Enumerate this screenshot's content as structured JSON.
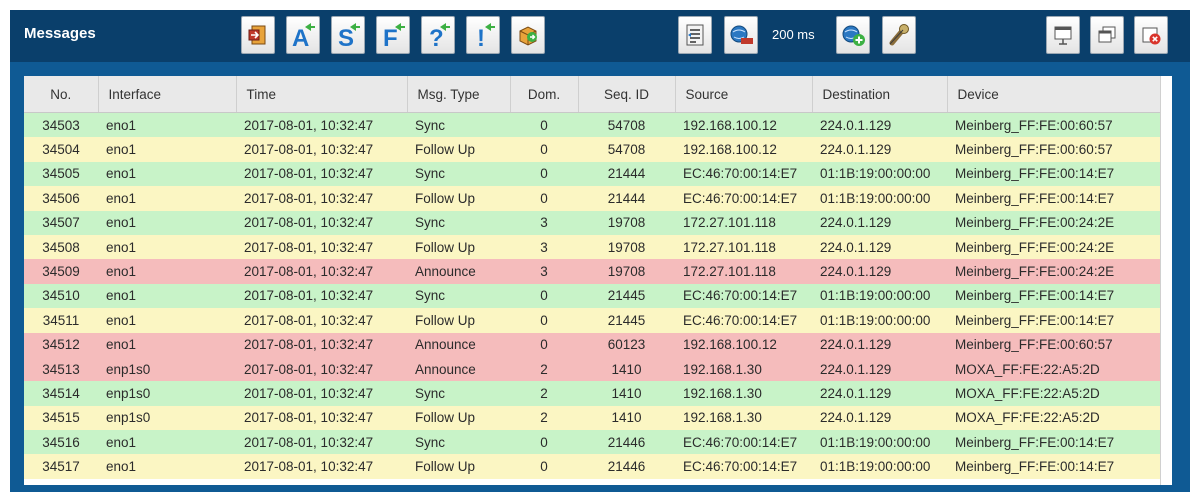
{
  "header": {
    "title": "Messages",
    "speed": "200 ms"
  },
  "toolbar": {
    "capture_icons": [
      "log-export-icon",
      "filter-all-icon",
      "filter-sync-icon",
      "filter-followup-icon",
      "filter-query-icon",
      "filter-flag-icon",
      "export-box-icon"
    ],
    "control_icons": [
      "list-settings-icon",
      "stop-capture-icon",
      "add-network-icon",
      "wrench-icon"
    ],
    "window_icons": [
      "detach-window-icon",
      "restore-window-icon",
      "close-window-icon"
    ]
  },
  "table": {
    "columns": [
      "No.",
      "Interface",
      "Time",
      "Msg. Type",
      "Dom.",
      "Seq. ID",
      "Source",
      "Destination",
      "Device"
    ],
    "rows": [
      {
        "type": "sync",
        "cells": [
          "34503",
          "eno1",
          "2017-08-01, 10:32:47",
          "Sync",
          "0",
          "54708",
          "192.168.100.12",
          "224.0.1.129",
          "Meinberg_FF:FE:00:60:57"
        ]
      },
      {
        "type": "follow",
        "cells": [
          "34504",
          "eno1",
          "2017-08-01, 10:32:47",
          "Follow Up",
          "0",
          "54708",
          "192.168.100.12",
          "224.0.1.129",
          "Meinberg_FF:FE:00:60:57"
        ]
      },
      {
        "type": "sync",
        "cells": [
          "34505",
          "eno1",
          "2017-08-01, 10:32:47",
          "Sync",
          "0",
          "21444",
          "EC:46:70:00:14:E7",
          "01:1B:19:00:00:00",
          "Meinberg_FF:FE:00:14:E7"
        ]
      },
      {
        "type": "follow",
        "cells": [
          "34506",
          "eno1",
          "2017-08-01, 10:32:47",
          "Follow Up",
          "0",
          "21444",
          "EC:46:70:00:14:E7",
          "01:1B:19:00:00:00",
          "Meinberg_FF:FE:00:14:E7"
        ]
      },
      {
        "type": "sync",
        "cells": [
          "34507",
          "eno1",
          "2017-08-01, 10:32:47",
          "Sync",
          "3",
          "19708",
          "172.27.101.118",
          "224.0.1.129",
          "Meinberg_FF:FE:00:24:2E"
        ]
      },
      {
        "type": "follow",
        "cells": [
          "34508",
          "eno1",
          "2017-08-01, 10:32:47",
          "Follow Up",
          "3",
          "19708",
          "172.27.101.118",
          "224.0.1.129",
          "Meinberg_FF:FE:00:24:2E"
        ]
      },
      {
        "type": "announce",
        "cells": [
          "34509",
          "eno1",
          "2017-08-01, 10:32:47",
          "Announce",
          "3",
          "19708",
          "172.27.101.118",
          "224.0.1.129",
          "Meinberg_FF:FE:00:24:2E"
        ]
      },
      {
        "type": "sync",
        "cells": [
          "34510",
          "eno1",
          "2017-08-01, 10:32:47",
          "Sync",
          "0",
          "21445",
          "EC:46:70:00:14:E7",
          "01:1B:19:00:00:00",
          "Meinberg_FF:FE:00:14:E7"
        ]
      },
      {
        "type": "follow",
        "cells": [
          "34511",
          "eno1",
          "2017-08-01, 10:32:47",
          "Follow Up",
          "0",
          "21445",
          "EC:46:70:00:14:E7",
          "01:1B:19:00:00:00",
          "Meinberg_FF:FE:00:14:E7"
        ]
      },
      {
        "type": "announce",
        "cells": [
          "34512",
          "eno1",
          "2017-08-01, 10:32:47",
          "Announce",
          "0",
          "60123",
          "192.168.100.12",
          "224.0.1.129",
          "Meinberg_FF:FE:00:60:57"
        ]
      },
      {
        "type": "announce",
        "cells": [
          "34513",
          "enp1s0",
          "2017-08-01, 10:32:47",
          "Announce",
          "2",
          "1410",
          "192.168.1.30",
          "224.0.1.129",
          "MOXA_FF:FE:22:A5:2D"
        ]
      },
      {
        "type": "sync",
        "cells": [
          "34514",
          "enp1s0",
          "2017-08-01, 10:32:47",
          "Sync",
          "2",
          "1410",
          "192.168.1.30",
          "224.0.1.129",
          "MOXA_FF:FE:22:A5:2D"
        ]
      },
      {
        "type": "follow",
        "cells": [
          "34515",
          "enp1s0",
          "2017-08-01, 10:32:47",
          "Follow Up",
          "2",
          "1410",
          "192.168.1.30",
          "224.0.1.129",
          "MOXA_FF:FE:22:A5:2D"
        ]
      },
      {
        "type": "sync",
        "cells": [
          "34516",
          "eno1",
          "2017-08-01, 10:32:47",
          "Sync",
          "0",
          "21446",
          "EC:46:70:00:14:E7",
          "01:1B:19:00:00:00",
          "Meinberg_FF:FE:00:14:E7"
        ]
      },
      {
        "type": "follow",
        "cells": [
          "34517",
          "eno1",
          "2017-08-01, 10:32:47",
          "Follow Up",
          "0",
          "21446",
          "EC:46:70:00:14:E7",
          "01:1B:19:00:00:00",
          "Meinberg_FF:FE:00:14:E7"
        ]
      }
    ]
  },
  "colors": {
    "frame": "#0f5a94",
    "titlebar": "#0a3f6b",
    "sync": "#c8f3c8",
    "follow_up": "#fbf6c3",
    "announce": "#f5bcbc"
  }
}
